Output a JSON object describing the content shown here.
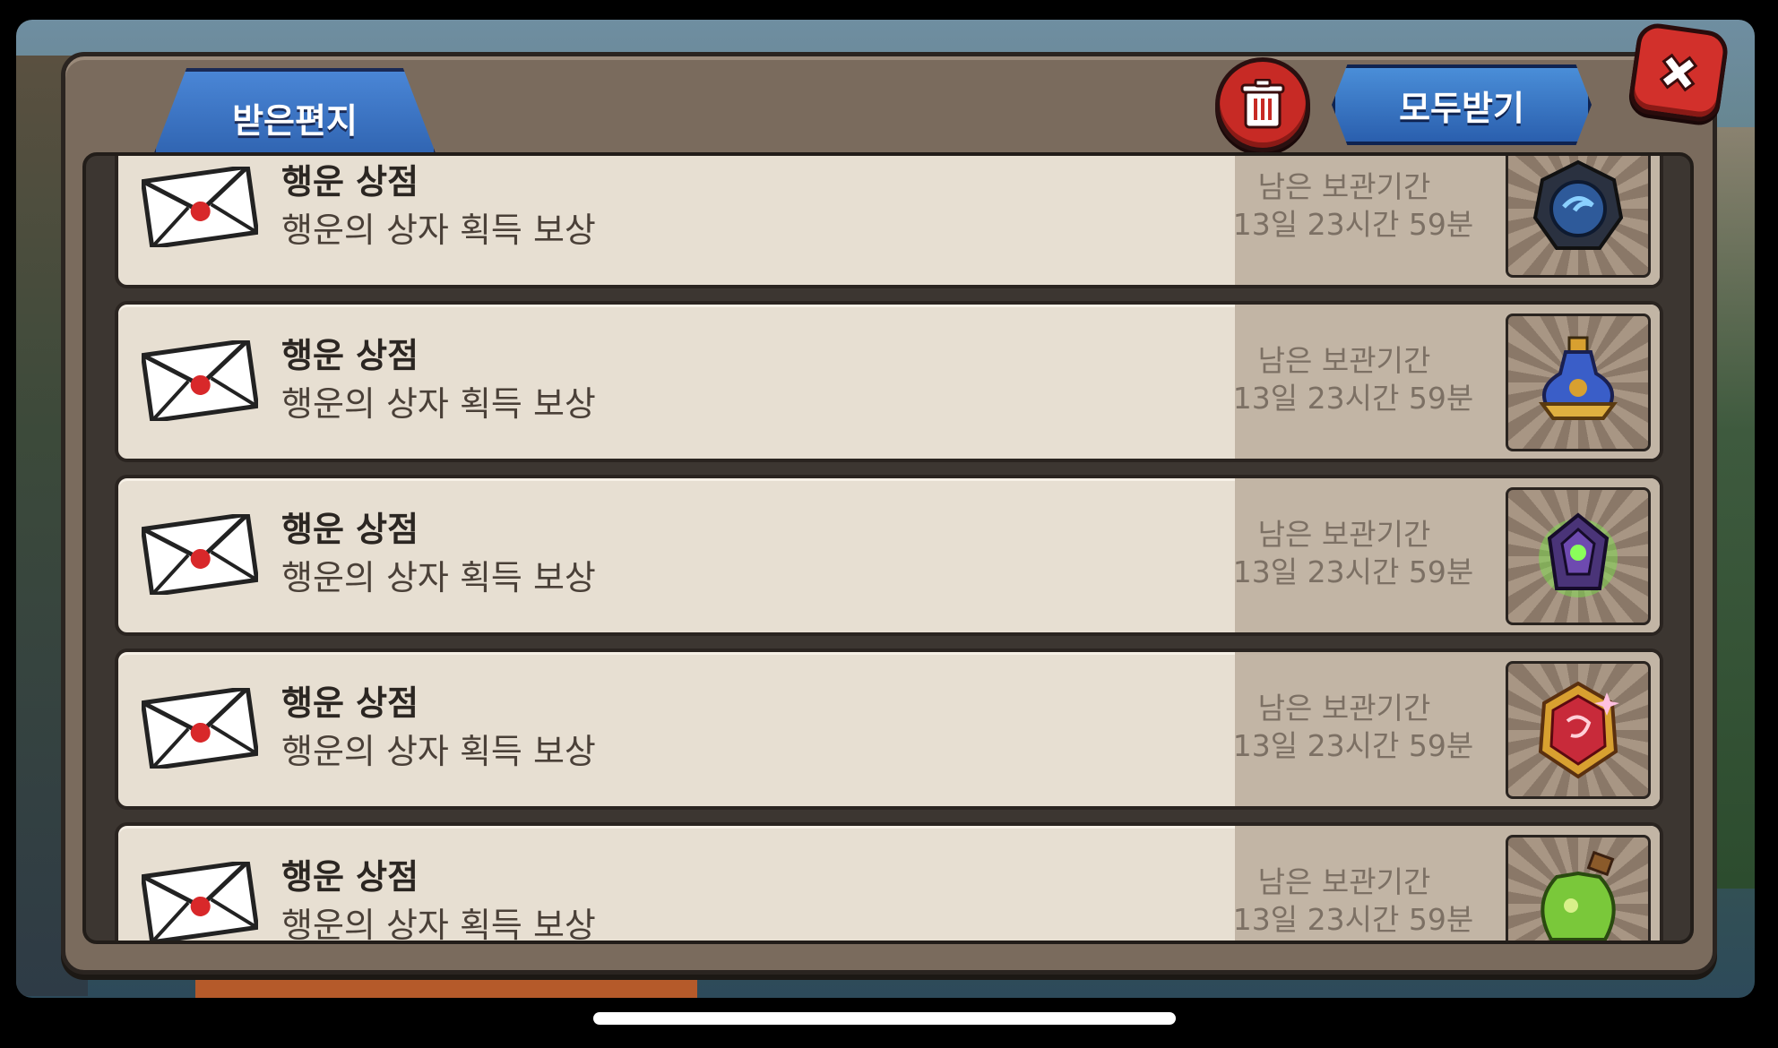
{
  "header": {
    "tab_label": "받은편지",
    "claim_all_label": "모두받기",
    "trash_icon": "trash-icon",
    "close_icon": "close-icon"
  },
  "mails": [
    {
      "title": "행운 상점",
      "description": "행운의 상자 획득 보상",
      "keep_label": "남은 보관기간",
      "keep_time": "13일 23시간 59분",
      "reward_icon": "dark-orb-icon",
      "reward_color": "#2e5a9a"
    },
    {
      "title": "행운 상점",
      "description": "행운의 상자 획득 보상",
      "keep_label": "남은 보관기간",
      "keep_time": "13일 23시간 59분",
      "reward_icon": "potion-flask-icon",
      "reward_color": "#d8a030"
    },
    {
      "title": "행운 상점",
      "description": "행운의 상자 획득 보상",
      "keep_label": "남은 보관기간",
      "keep_time": "13일 23시간 59분",
      "reward_icon": "dark-gem-icon",
      "reward_color": "#5a3a8a"
    },
    {
      "title": "행운 상점",
      "description": "행운의 상자 획득 보상",
      "keep_label": "남은 보관기간",
      "keep_time": "13일 23시간 59분",
      "reward_icon": "ruby-emblem-icon",
      "reward_color": "#c82a3a"
    },
    {
      "title": "행운 상점",
      "description": "행운의 상자 획득 보상",
      "keep_label": "남은 보관기간",
      "keep_time": "13일 23시간 59분",
      "reward_icon": "green-potion-icon",
      "reward_color": "#7ac83a"
    }
  ],
  "colors": {
    "tab_blue": "#3a74c4",
    "button_red": "#c72a25",
    "mail_bg": "#e7dfd2",
    "mail_right_bg": "#c2b5a5",
    "envelope_seal": "#d8282a"
  }
}
